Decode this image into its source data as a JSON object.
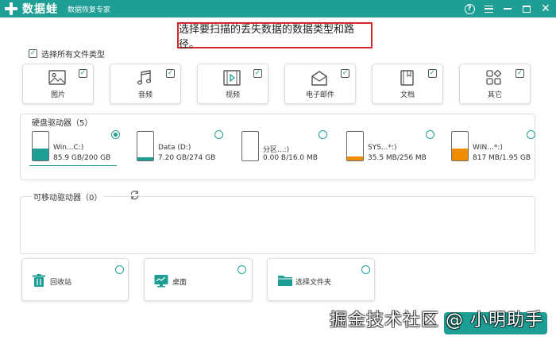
{
  "app": {
    "name": "数据蛙",
    "subtitle": "数据恢复专家",
    "accent_color": "#1e9e95"
  },
  "instruction": "选择要扫描的丢失数据的数据类型和路径。",
  "select_all": {
    "label": "选择所有文件类型",
    "checked": true
  },
  "file_types": [
    {
      "label": "图片",
      "icon": "image-icon",
      "checked": true
    },
    {
      "label": "音频",
      "icon": "music-icon",
      "checked": true
    },
    {
      "label": "视频",
      "icon": "video-icon",
      "checked": true
    },
    {
      "label": "电子邮件",
      "icon": "email-icon",
      "checked": true
    },
    {
      "label": "文档",
      "icon": "document-icon",
      "checked": true
    },
    {
      "label": "其它",
      "icon": "other-icon",
      "checked": true
    }
  ],
  "hard_drives": {
    "title": "硬盘驱动器（5）",
    "drives": [
      {
        "name": "Win...C:)",
        "size": "85.9 GB/200 GB",
        "used_fraction": 0.43,
        "fill_color": "#1e9e95",
        "selected": true
      },
      {
        "name": "Data (D:)",
        "size": "7.20 GB/274 GB",
        "used_fraction": 0.03,
        "fill_color": "#1e9e95",
        "selected": false
      },
      {
        "name": "分区...:)",
        "size": "0.00  B/16.0 MB",
        "used_fraction": 0.0,
        "fill_color": "#f08c00",
        "selected": false
      },
      {
        "name": "SYS...*:)",
        "size": "35.5 MB/256 MB",
        "used_fraction": 0.14,
        "fill_color": "#f08c00",
        "selected": false
      },
      {
        "name": "WIN...*:)",
        "size": "817 MB/1.95 GB",
        "used_fraction": 0.42,
        "fill_color": "#f08c00",
        "selected": false
      }
    ]
  },
  "removable_drives": {
    "title": "可移动驱动器（0）",
    "refresh_icon": "refresh-icon"
  },
  "locations": [
    {
      "label": "回收站",
      "icon": "trash-icon"
    },
    {
      "label": "桌面",
      "icon": "desktop-icon"
    },
    {
      "label": "选择文件夹",
      "icon": "folder-icon"
    }
  ],
  "watermark": "掘金技术社区 @ 小明助手"
}
